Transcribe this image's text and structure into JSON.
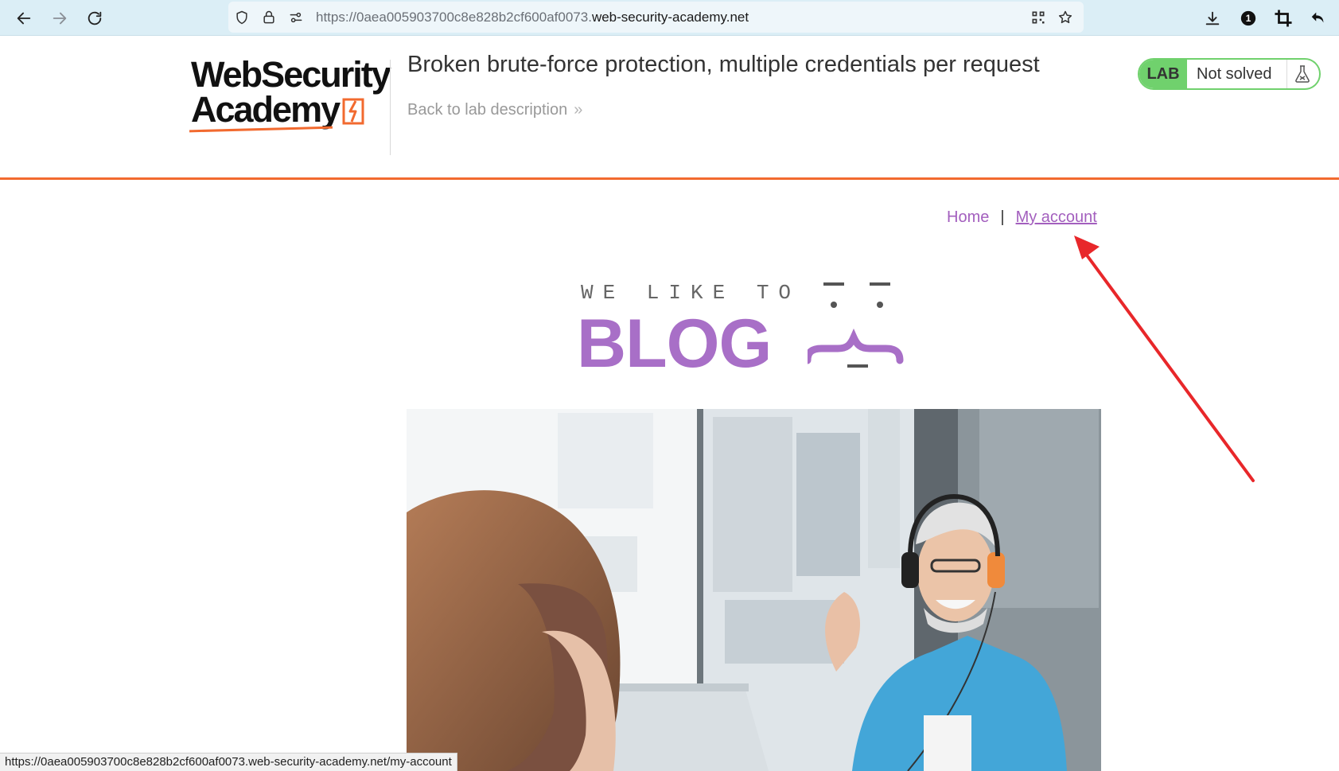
{
  "browser": {
    "url_prefix": "https://0aea005903700c8e828b2cf600af0073.",
    "url_domain": "web-security-academy.net",
    "notification_count": "1",
    "status_link": "https://0aea005903700c8e828b2cf600af0073.web-security-academy.net/my-account",
    "icons": [
      "back-arrow-icon",
      "forward-arrow-icon",
      "reload-icon",
      "shield-icon",
      "lock-icon",
      "permissions-icon",
      "qr-code-icon",
      "bookmark-star-icon",
      "download-icon",
      "extension-badge-icon",
      "crop-icon",
      "undo-icon"
    ]
  },
  "lab_header": {
    "logo_line1": "WebSecurity",
    "logo_line2": "Academy",
    "title": "Broken brute-force protection, multiple credentials per request",
    "back_link": "Back to lab description",
    "back_chevrons": "»",
    "status_label": "LAB",
    "status_text": "Not solved"
  },
  "nav": {
    "home": "Home",
    "separator": "|",
    "my_account": "My account"
  },
  "banner": {
    "small_text": "WE LIKE TO",
    "big_text": "BLOG"
  },
  "colors": {
    "accent_orange": "#f26a2f",
    "status_green": "#70d16d",
    "link_purple": "#a35fbe",
    "banner_purple": "#a86fc7",
    "annotation_red": "#e8272a",
    "toolbar_bg": "#dbeef6"
  }
}
